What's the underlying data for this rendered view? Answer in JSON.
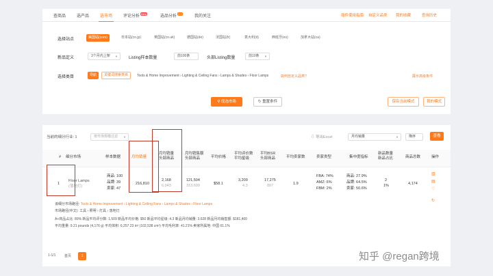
{
  "tabs": [
    {
      "label": "查商品"
    },
    {
      "label": "选产品"
    },
    {
      "label": "选市场"
    },
    {
      "label": "评论分析",
      "badge": "New",
      "badge_color": "#ff4d4f"
    },
    {
      "label": "选品分析",
      "badge": "2.0",
      "badge_color": "#ff7a1a"
    },
    {
      "label": "我的关注"
    }
  ],
  "top_links": [
    "插件使用指南",
    "自定义品类",
    "我的收藏",
    "查询历史"
  ],
  "filters": {
    "site_label": "选择站点",
    "sites": [
      "美国站(com)",
      "日本站(co.jp)",
      "英国站(co.uk)",
      "德国站(de)",
      "法国站(fr)",
      "意大利(it)",
      "西班牙(es)",
      "加拿大站(ca)"
    ],
    "new_def_label": "新品定义",
    "new_def_value": "3个月内上架",
    "listing_label": "Listing样本数量",
    "listing_value": "前100条",
    "head_label": "头部Listing数量",
    "head_value": "前10条",
    "category_label": "选择类目",
    "cat_toggle_a": "导航",
    "cat_toggle_b": "关键词搜索类目",
    "category_path": "Tools & Home Improvement  ›  Lighting & Ceiling Fans  ›  Lamps & Shades  ›  Floor Lamps",
    "category_help": "如何自定义品类?",
    "advanced": "展示高级条件",
    "btn_analyze": "找选市场",
    "btn_reset": "重置条件",
    "btn_save": "保存当前模式",
    "btn_my": "我的模式"
  },
  "results": {
    "show_label": "当前的细分行业: 1",
    "sort_placeholder": "按市场规模过滤",
    "export": "导出Excel",
    "metric_select": "月均销量",
    "order_select": "降序",
    "search_btn": "查看",
    "headers": {
      "rank": "#",
      "market": "细分市场",
      "sample": "样本数据",
      "monthly_sales": "月均销量",
      "head_monthly": "月均销量\n头部商品",
      "head_revenue": "月均销售额\n头部商品",
      "avg_price": "平均价格",
      "avg_reviews": "平均评价数\n平均星级",
      "avg_bsr": "平均BSR\n头部商品",
      "avg_sellers": "平均卖家数",
      "seller_type": "卖家类型",
      "concentration": "集中度指标",
      "new_ratio": "新品数量\n新品占比",
      "product_count": "商品总数",
      "action": "操作"
    },
    "row": {
      "rank": "1",
      "market_name": "Floor Lamps",
      "market_sub": "(落地灯)",
      "sample_a": "商品: 100",
      "sample_b": "品牌: 39",
      "sample_c": "卖家: 47",
      "monthly_sales": "216,810",
      "head_monthly": "2,168",
      "head_monthly_sub": "6,043",
      "head_revenue": "121,504",
      "head_revenue_sub": "313,699",
      "avg_price": "$58.1",
      "avg_reviews": "3,209",
      "avg_stars": "4.3",
      "avg_bsr": "17,275",
      "avg_bsr_sub": "897",
      "avg_sellers": "1.9",
      "seller_fba": "FBA: 74%",
      "seller_amz": "AMZ: 6%",
      "seller_fbm": "FBM: 2%",
      "conc_a": "商品: 27.9%",
      "conc_b": "品牌: 64.5%",
      "conc_c": "卖家: 50.6%",
      "new_count": "2",
      "new_ratio": "1%",
      "product_count": "4,174"
    },
    "meta_line1_label": "该细分市场路径:",
    "meta_line1_path": "Tools & Home Improvement › Lighting & Ceiling Fans › Lamps & Shades › Floor Lamps",
    "meta_line2": "市场路径(中文): 工具 › 照明 › 灯具 › 落地灯",
    "meta_line3": "A+商品占比: 89%    新品平均评分数: 1,509    新品平均价格: $50    新品平均星级: 4.3    新品月均销量: 3,628    新品月均销售额: $181,400",
    "meta_line4": "平均重量: 9.21 pounds (4,176 g)    平均体积: 6,257.23 in³ (102,538 cm³)    平均毛利率: 41.21%    卖家所属地: 中国 61.1%",
    "pager_total": "1-1/1",
    "pager_first": "首页",
    "pager_current": "1"
  },
  "watermark": "知乎 @regan跨境"
}
